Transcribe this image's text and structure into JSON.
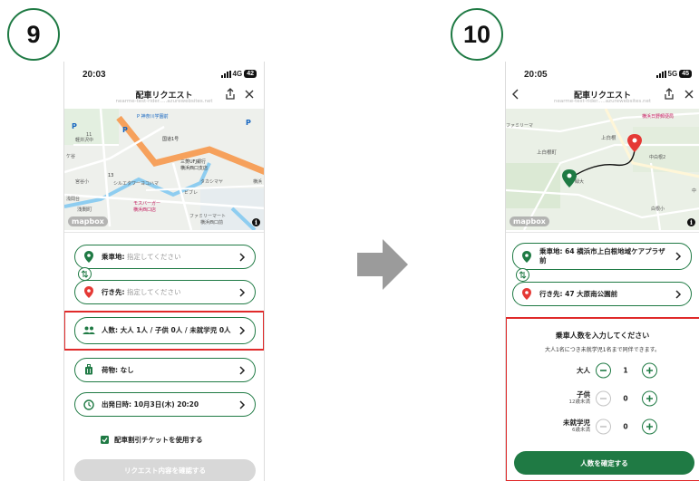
{
  "steps": {
    "left": "9",
    "right": "10"
  },
  "colors": {
    "brand_green": "#1f7a44",
    "highlight_red": "#e02a2a",
    "origin_pin": "#1f7a44",
    "destination_pin": "#e53935"
  },
  "left_screen": {
    "status": {
      "time": "20:03",
      "network": "4G",
      "battery": "42"
    },
    "header": {
      "title": "配車リクエスト",
      "url": "nearme-test-rider.....azurewebsites.net"
    },
    "map": {
      "labels": [
        "P",
        "P 神奈川学園前",
        "P",
        "国道1号",
        "P",
        "ケ谷",
        "軽井沢中",
        "11",
        "三菱UFJ銀行",
        "横浜西口支店",
        "シルエタワーヨコハマ",
        "タカシマヤ",
        "ビブレ",
        "浅間台",
        "浅間町",
        "モスバーガー",
        "横浜西口店",
        "ファミリーマート",
        "横浜西口前",
        "横浜",
        "宮谷小",
        "13"
      ],
      "attribution": "mapbox"
    },
    "pickup": {
      "label": "乗車地:",
      "value": "指定してください"
    },
    "dropoff": {
      "label": "行き先:",
      "value": "指定してください"
    },
    "passengers": {
      "label": "人数:",
      "value": "大人 1人 / 子供 0人 / 未就学児 0人"
    },
    "luggage": {
      "label": "荷物:",
      "value": "なし"
    },
    "departure": {
      "label": "出発日時:",
      "value": "10月3日(木) 20:20"
    },
    "discount_ticket": {
      "label": "配車割引チケットを使用する",
      "checked": true
    },
    "confirm_button": "リクエスト内容を確認する"
  },
  "right_screen": {
    "status": {
      "time": "20:05",
      "network": "5G",
      "battery": "45"
    },
    "header": {
      "title": "配車リクエスト",
      "url": "nearme-test-rider.....azurewebsites.net"
    },
    "map": {
      "labels": [
        "横浜日野郵便局",
        "ファミリーマ",
        "上白根",
        "上白根町",
        "中白根2",
        "緑大",
        "白根小",
        "中"
      ],
      "attribution": "mapbox"
    },
    "pickup": {
      "label": "乗車地:",
      "value": "64 横浜市上白根地域ケアプラザ前"
    },
    "dropoff": {
      "label": "行き先:",
      "value": "47 大原南公園前"
    },
    "passenger_panel": {
      "title": "乗車人数を入力してください",
      "note": "大人1名につき未就学児1名まで同伴できます。",
      "rows": [
        {
          "label": "大人",
          "sub": "",
          "value": "1",
          "minus_enabled": true
        },
        {
          "label": "子供",
          "sub": "12歳未満",
          "value": "0",
          "minus_enabled": false
        },
        {
          "label": "未就学児",
          "sub": "6歳未満",
          "value": "0",
          "minus_enabled": false
        }
      ],
      "confirm_button": "人数を確定する"
    }
  }
}
